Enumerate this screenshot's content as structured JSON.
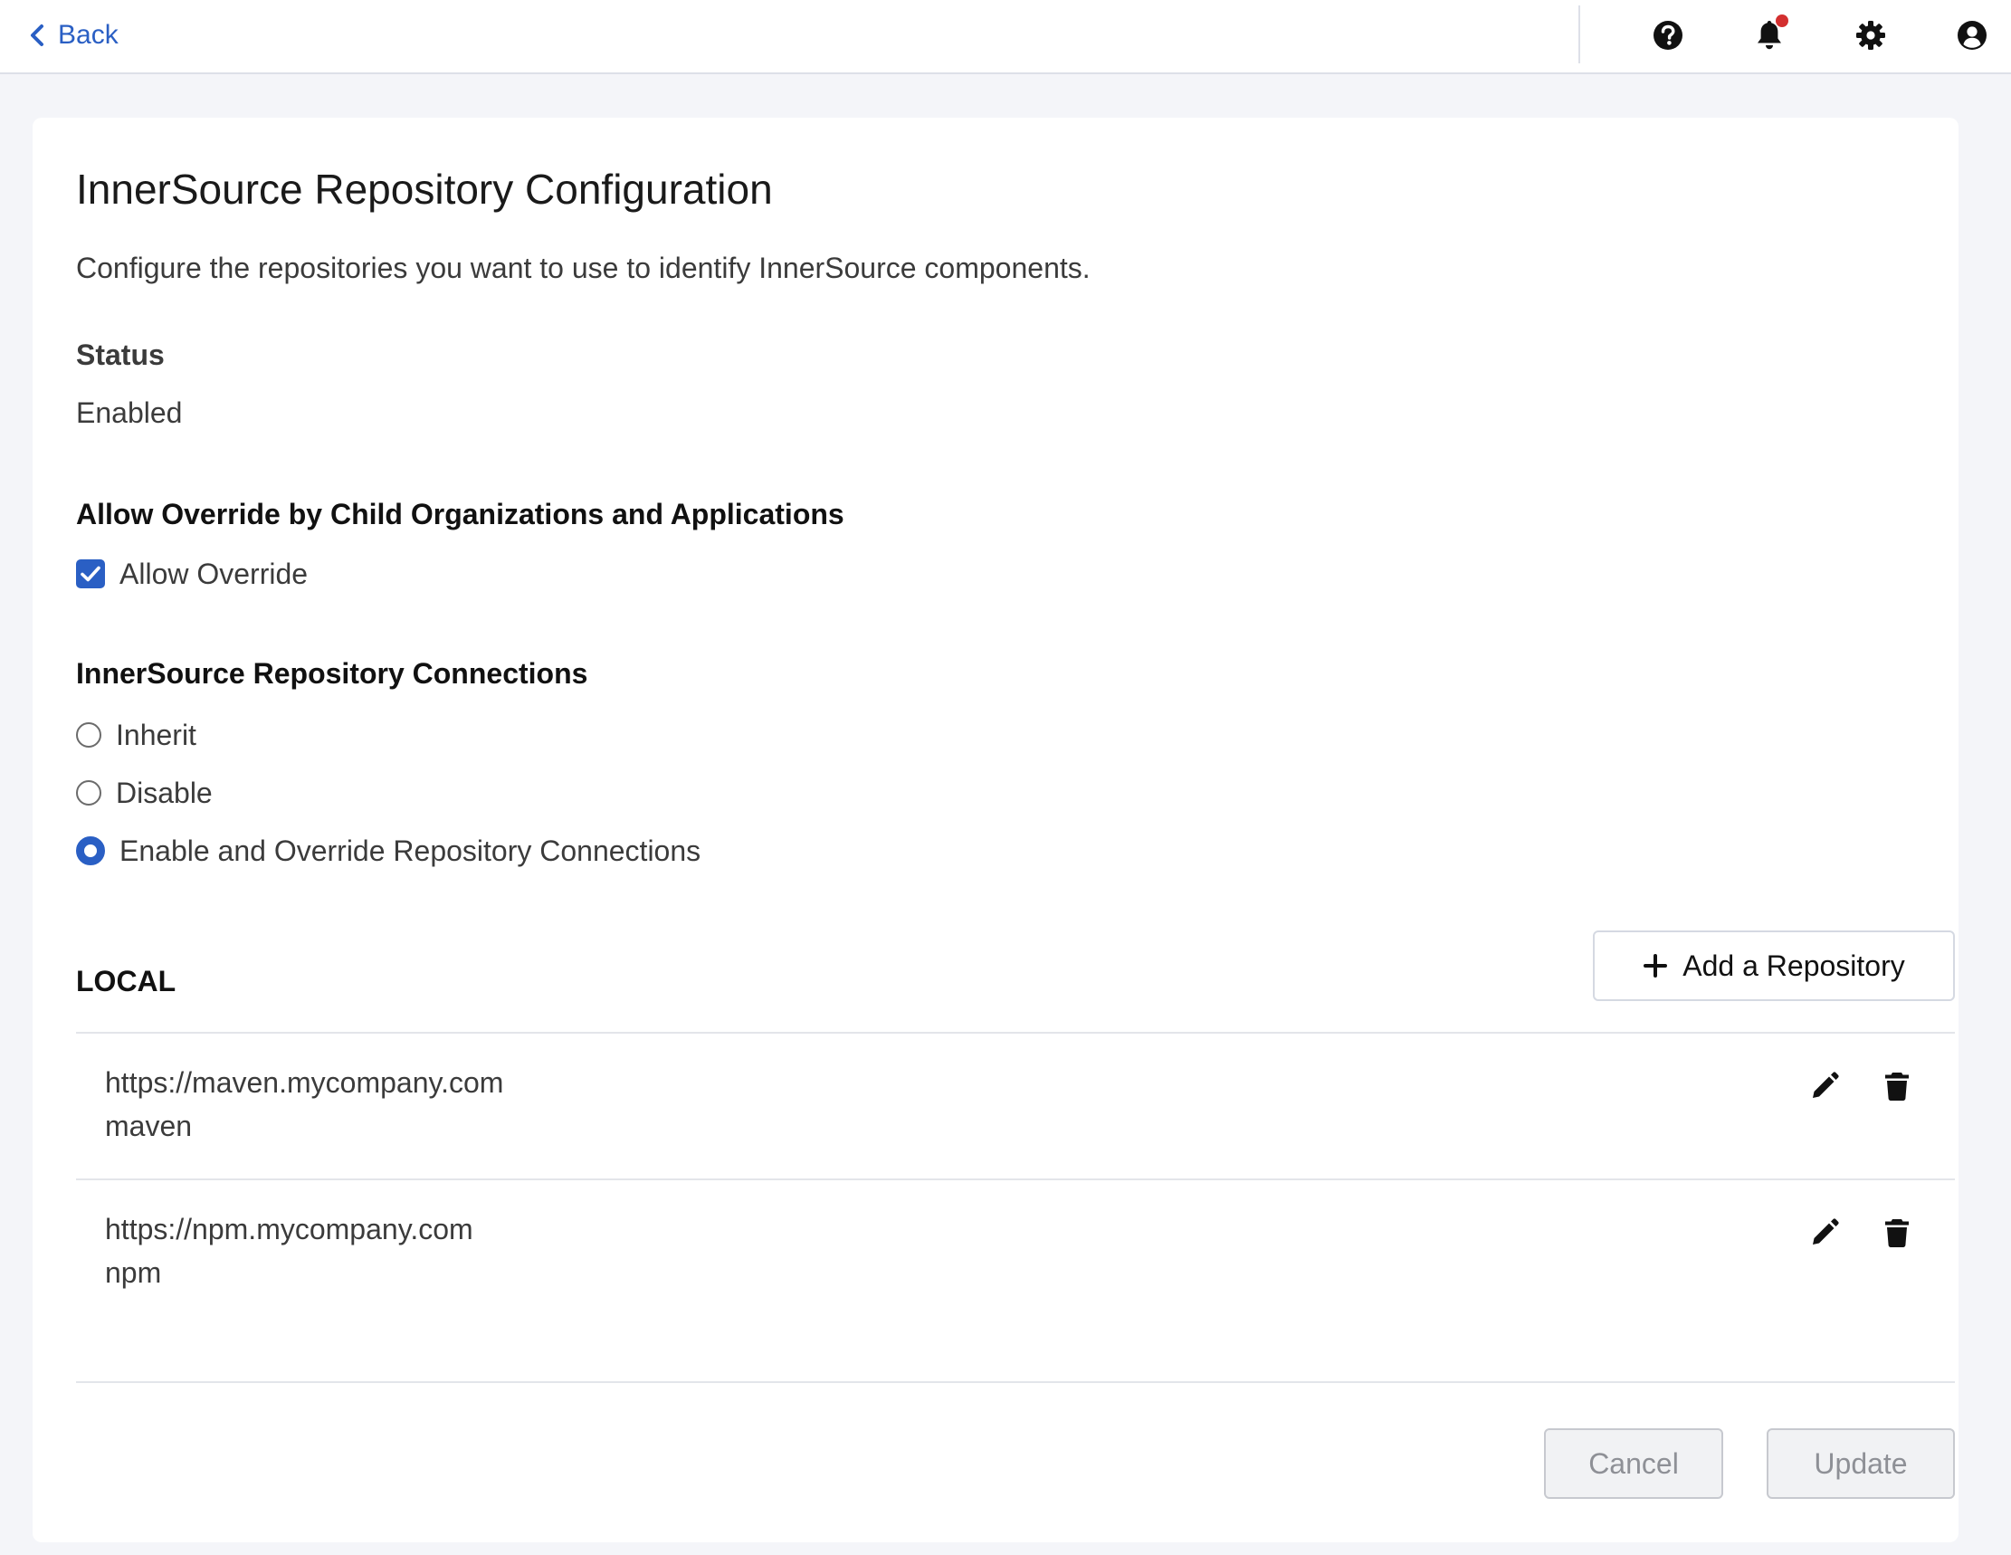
{
  "header": {
    "back_label": "Back",
    "icons": [
      "help-icon",
      "bell-icon",
      "gear-icon",
      "user-icon"
    ],
    "notification_dot_color": "#d32f2f"
  },
  "page": {
    "title": "InnerSource Repository Configuration",
    "description": "Configure the repositories you want to use to identify InnerSource components."
  },
  "status": {
    "label": "Status",
    "value": "Enabled"
  },
  "override": {
    "heading": "Allow Override by Child Organizations and Applications",
    "checkbox_label": "Allow Override",
    "checked": true
  },
  "connections": {
    "heading": "InnerSource Repository Connections",
    "options": [
      {
        "label": "Inherit",
        "selected": false
      },
      {
        "label": "Disable",
        "selected": false
      },
      {
        "label": "Enable and Override Repository Connections",
        "selected": true
      }
    ]
  },
  "local": {
    "heading": "LOCAL",
    "add_button_label": "Add a Repository",
    "repositories": [
      {
        "url": "https://maven.mycompany.com",
        "format": "maven"
      },
      {
        "url": "https://npm.mycompany.com",
        "format": "npm"
      }
    ]
  },
  "footer": {
    "cancel_label": "Cancel",
    "update_label": "Update"
  },
  "colors": {
    "accent": "#2a5fc4",
    "page_background": "#f4f5f9",
    "disabled_text": "#8e9096"
  }
}
